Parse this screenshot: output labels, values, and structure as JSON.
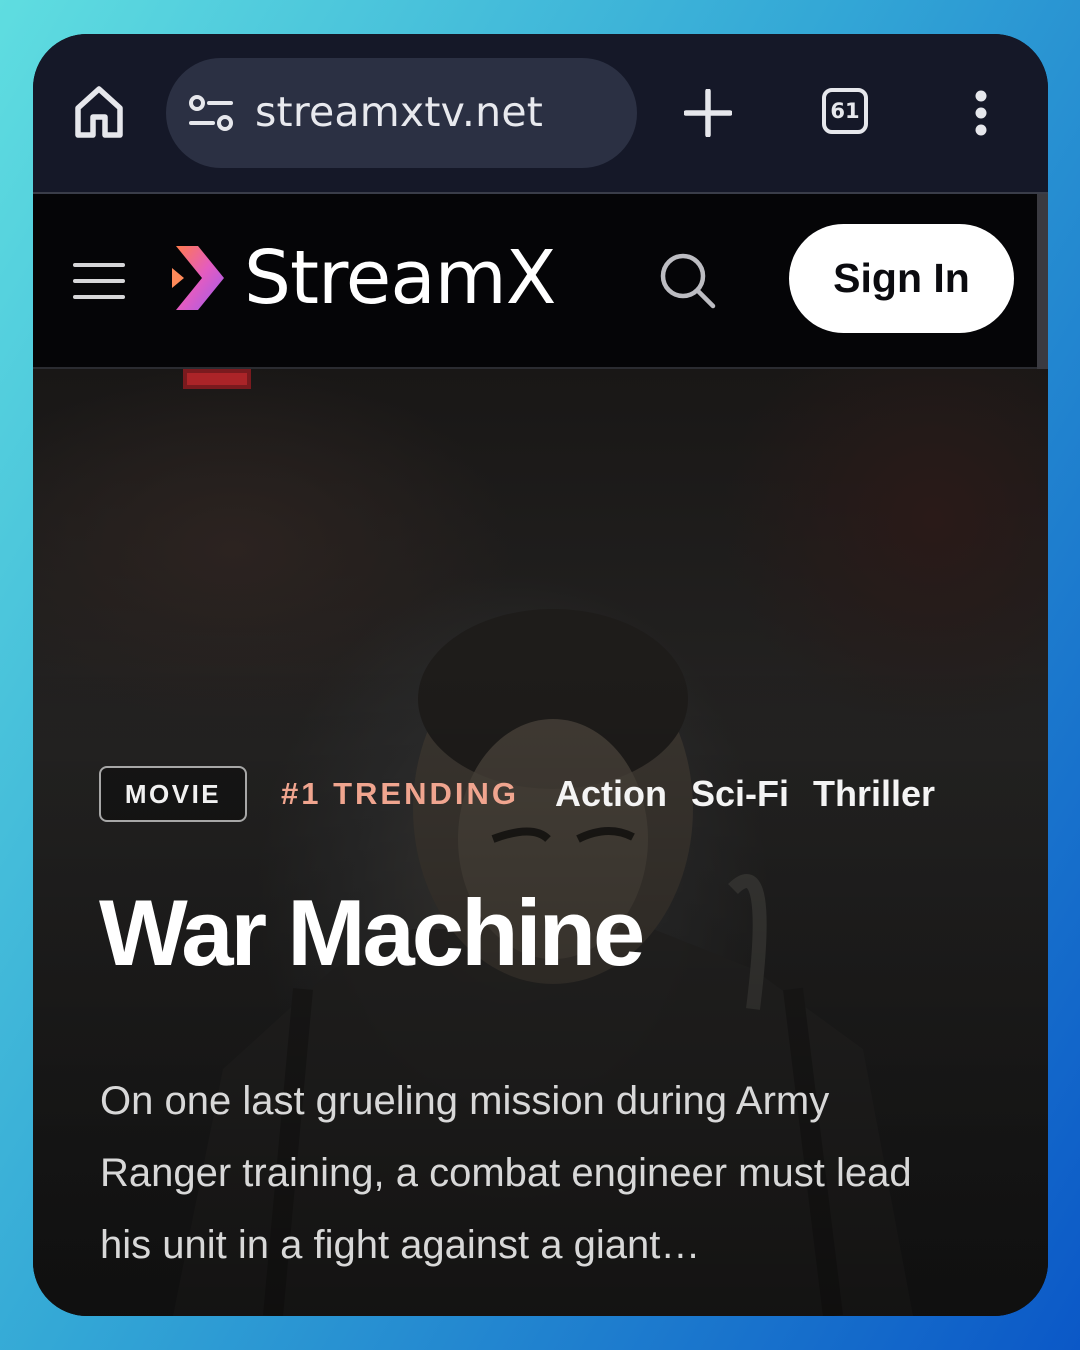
{
  "browser": {
    "url": "streamxtv.net",
    "tab_count": "61"
  },
  "site": {
    "brand": "StreamX",
    "brand_color": "#c96cf0",
    "sign_in_label": "Sign In"
  },
  "hero": {
    "badge": "MOVIE",
    "trending": "#1 TRENDING",
    "trending_color": "#f0a58f",
    "genres": [
      "Action",
      "Sci-Fi",
      "Thriller"
    ],
    "title": "War Machine",
    "description": "On one last grueling mission during Army Ranger training, a combat engineer must lead his unit in a fight against a giant…"
  }
}
